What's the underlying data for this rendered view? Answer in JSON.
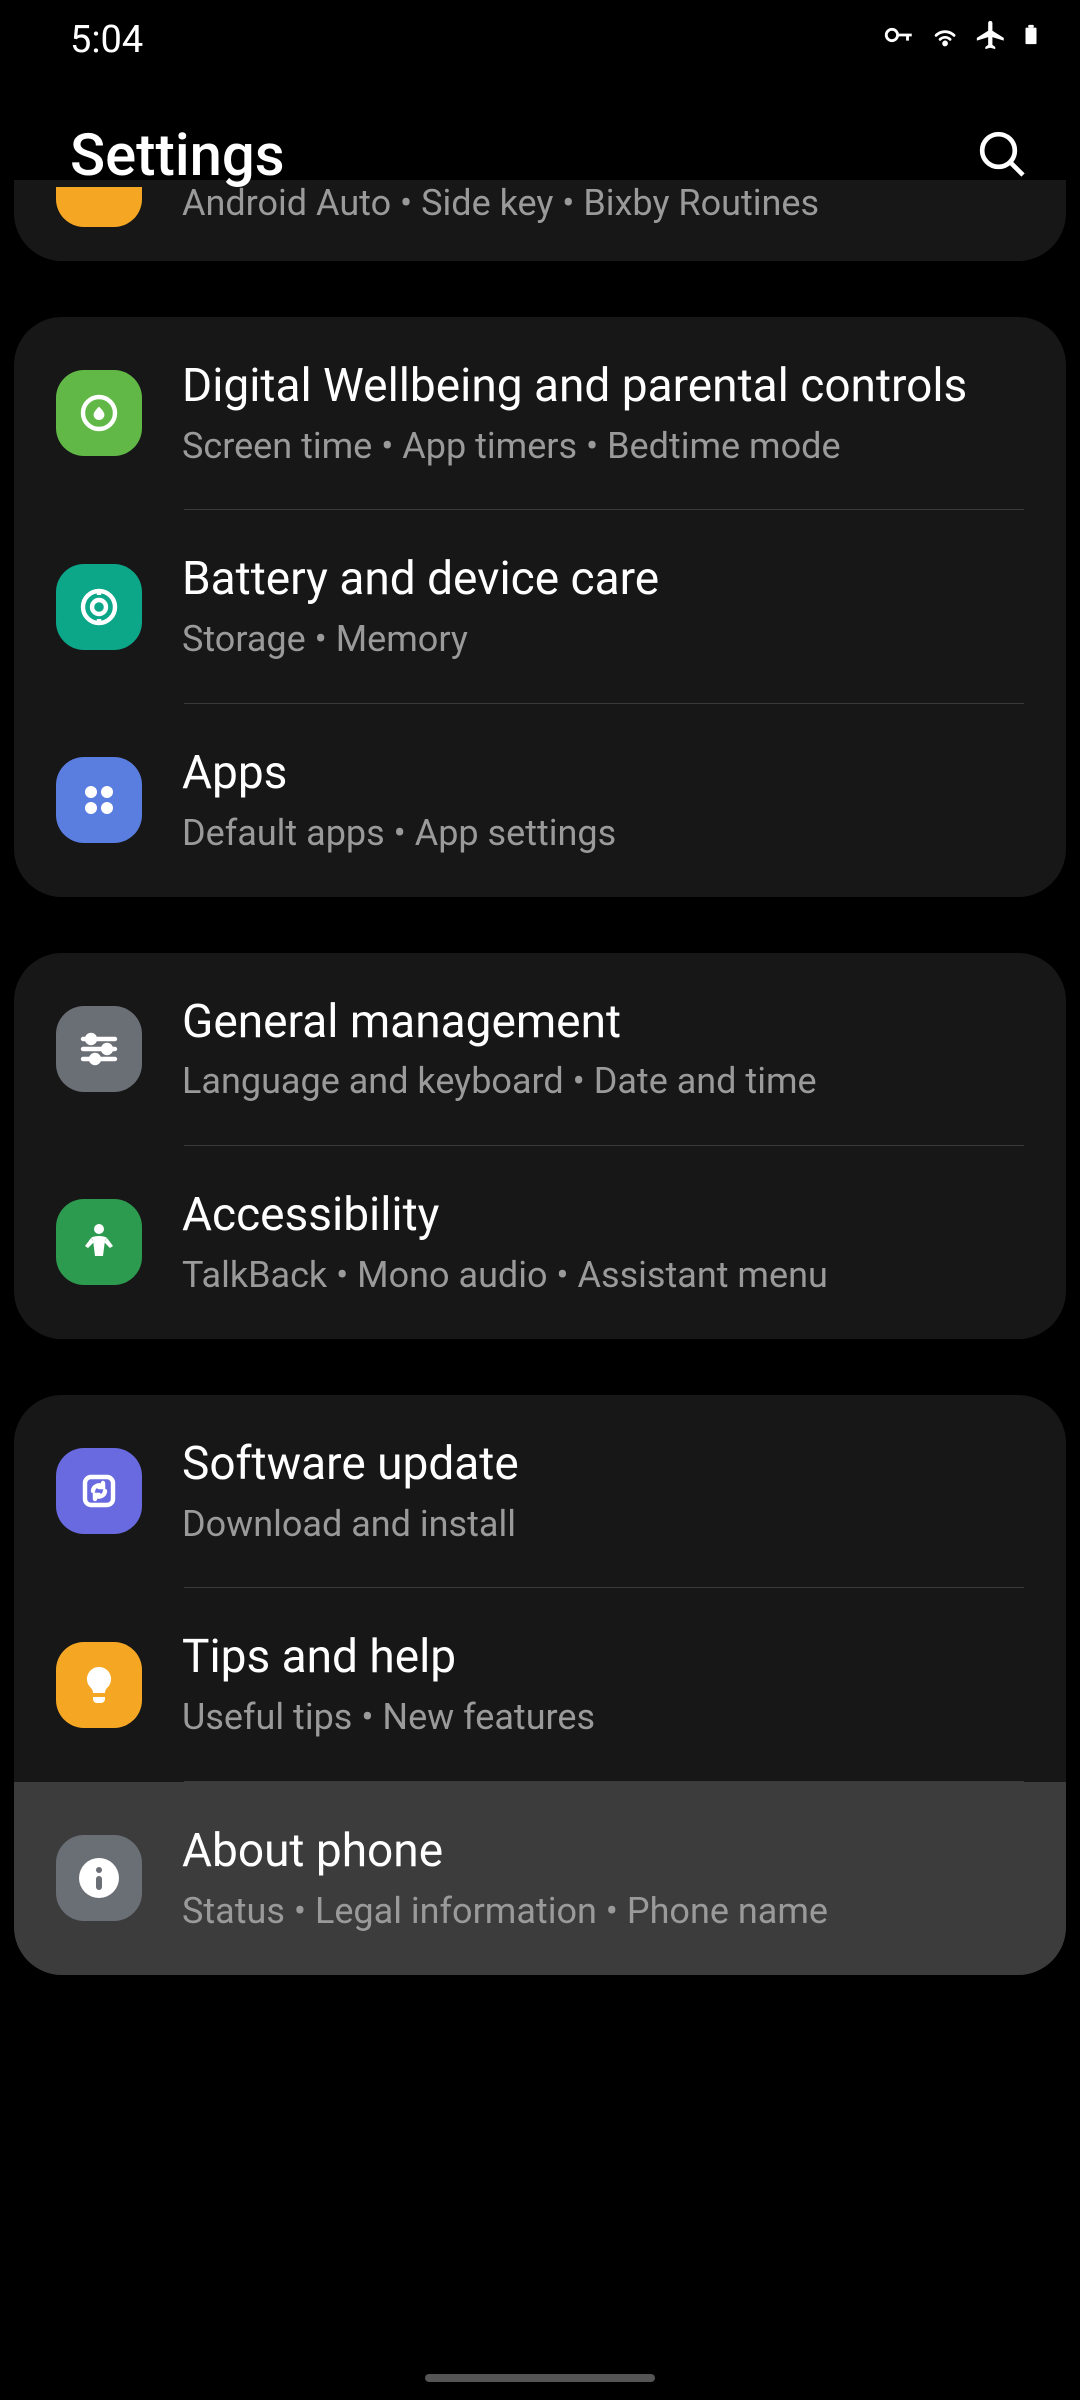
{
  "status": {
    "time": "5:04"
  },
  "header": {
    "title": "Settings"
  },
  "partialItem": {
    "subtitle": "Android Auto  •  Side key  •  Bixby Routines"
  },
  "groups": [
    {
      "items": [
        {
          "id": "digital-wellbeing",
          "title": "Digital Wellbeing and parental controls",
          "subtitle": "Screen time  •  App timers  •  Bedtime mode",
          "iconBg": "#62b846",
          "icon": "wellbeing"
        },
        {
          "id": "battery",
          "title": "Battery and device care",
          "subtitle": "Storage  •  Memory",
          "iconBg": "#0ca789",
          "icon": "care"
        },
        {
          "id": "apps",
          "title": "Apps",
          "subtitle": "Default apps  •  App settings",
          "iconBg": "#5a7de0",
          "icon": "apps"
        }
      ]
    },
    {
      "items": [
        {
          "id": "general",
          "title": "General management",
          "subtitle": "Language and keyboard  •  Date and time",
          "iconBg": "#6a6e75",
          "icon": "sliders"
        },
        {
          "id": "accessibility",
          "title": "Accessibility",
          "subtitle": "TalkBack  •  Mono audio  •  Assistant menu",
          "iconBg": "#2d9b4f",
          "icon": "person"
        }
      ]
    },
    {
      "items": [
        {
          "id": "software-update",
          "title": "Software update",
          "subtitle": "Download and install",
          "iconBg": "#6a6ae0",
          "icon": "update"
        },
        {
          "id": "tips",
          "title": "Tips and help",
          "subtitle": "Useful tips  •  New features",
          "iconBg": "#f5a623",
          "icon": "bulb"
        },
        {
          "id": "about",
          "title": "About phone",
          "subtitle": "Status  •  Legal information  •  Phone name",
          "iconBg": "#6a6e75",
          "icon": "info",
          "highlighted": true
        }
      ]
    }
  ]
}
